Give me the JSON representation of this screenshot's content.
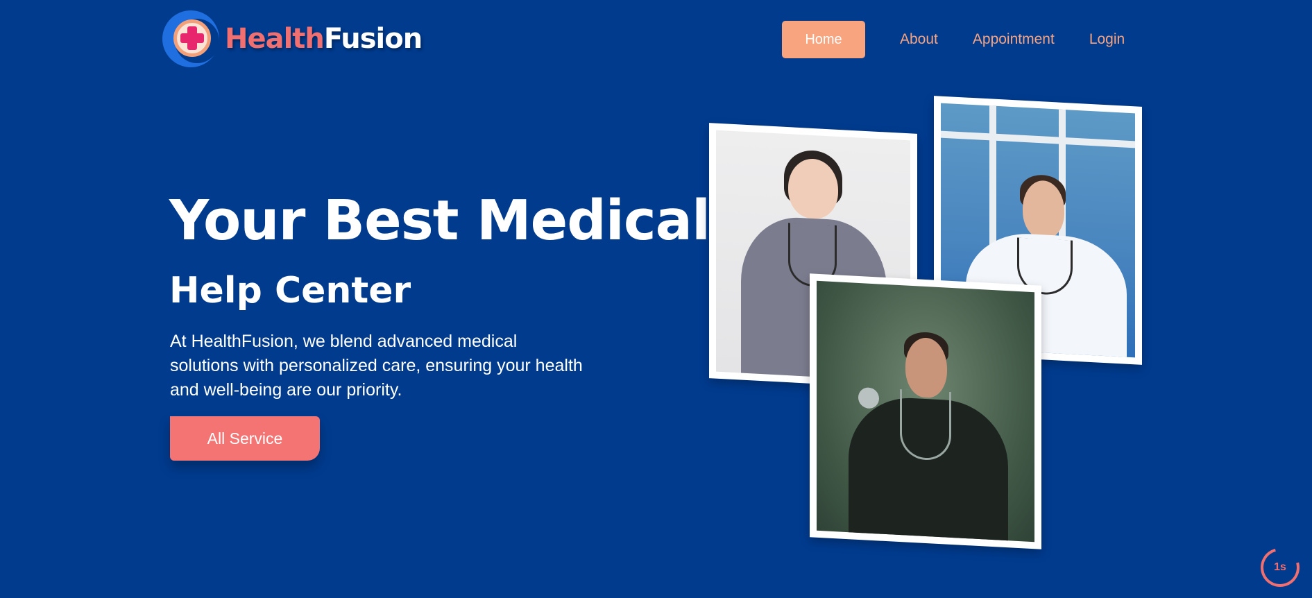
{
  "brand": {
    "name_part1": "Health",
    "name_part2": "Fusion",
    "logo_icon": "medical-cross-icon",
    "colors": {
      "accent": "#f07071",
      "background": "#003b8e",
      "nav_accent": "#f7a47f"
    }
  },
  "nav": {
    "items": [
      {
        "label": "Home",
        "active": true
      },
      {
        "label": "About",
        "active": false
      },
      {
        "label": "Appointment",
        "active": false
      },
      {
        "label": "Login",
        "active": false
      }
    ]
  },
  "hero": {
    "title": "Your Best Medical",
    "subtitle": "Help Center",
    "description": "At HealthFusion, we blend advanced medical solutions with personalized care, ensuring your health and well-being are our priority.",
    "cta_label": "All Service"
  },
  "photos": [
    {
      "name": "doctor-photo-female",
      "alt": ""
    },
    {
      "name": "doctor-photo-male-white-coat",
      "alt": ""
    },
    {
      "name": "doctor-photo-male-stethoscope",
      "alt": ""
    }
  ],
  "timer": {
    "label": "1s"
  }
}
